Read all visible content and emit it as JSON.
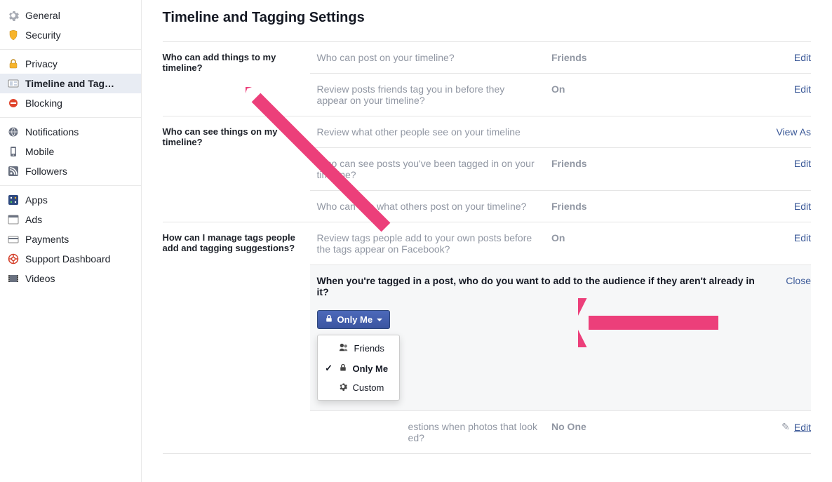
{
  "sidebar": {
    "groups": [
      {
        "items": [
          {
            "label": "General",
            "icon": "gear"
          },
          {
            "label": "Security",
            "icon": "shield"
          }
        ]
      },
      {
        "items": [
          {
            "label": "Privacy",
            "icon": "lock"
          },
          {
            "label": "Timeline and Tag…",
            "icon": "timeline",
            "active": true
          },
          {
            "label": "Blocking",
            "icon": "block"
          }
        ]
      },
      {
        "items": [
          {
            "label": "Notifications",
            "icon": "globe"
          },
          {
            "label": "Mobile",
            "icon": "mobile"
          },
          {
            "label": "Followers",
            "icon": "rss"
          }
        ]
      },
      {
        "items": [
          {
            "label": "Apps",
            "icon": "apps"
          },
          {
            "label": "Ads",
            "icon": "ads"
          },
          {
            "label": "Payments",
            "icon": "payments"
          },
          {
            "label": "Support Dashboard",
            "icon": "support"
          },
          {
            "label": "Videos",
            "icon": "videos"
          }
        ]
      }
    ]
  },
  "page": {
    "title": "Timeline and Tagging Settings"
  },
  "sections": [
    {
      "heading": "Who can add things to my timeline?",
      "rows": [
        {
          "label": "Who can post on your timeline?",
          "value": "Friends",
          "action": "Edit"
        },
        {
          "label": "Review posts friends tag you in before they appear on your timeline?",
          "value": "On",
          "action": "Edit"
        }
      ]
    },
    {
      "heading": "Who can see things on my timeline?",
      "rows": [
        {
          "label": "Review what other people see on your timeline",
          "value": "",
          "action": "View As"
        },
        {
          "label": "Who can see posts you've been tagged in on your timeline?",
          "value": "Friends",
          "action": "Edit"
        },
        {
          "label": "Who can see what others post on your timeline?",
          "value": "Friends",
          "action": "Edit"
        }
      ]
    },
    {
      "heading": "How can I manage tags people add and tagging suggestions?",
      "rows": [
        {
          "label": "Review tags people add to your own posts before the tags appear on Facebook?",
          "value": "On",
          "action": "Edit"
        },
        {
          "expanded": true,
          "question": "When you're tagged in a post, who do you want to add to the audience if they aren't already in it?",
          "button_label": "Only Me",
          "close_label": "Close",
          "dropdown": [
            {
              "label": "Friends",
              "icon": "friends"
            },
            {
              "label": "Only Me",
              "icon": "lock",
              "selected": true
            },
            {
              "label": "Custom",
              "icon": "custom"
            }
          ]
        },
        {
          "label": "Who sees tag suggestions when photos that look like you are uploaded?",
          "label_cut": "estions when photos that look\ned?",
          "value": "No One",
          "action": "Edit",
          "pencil": true
        }
      ]
    }
  ],
  "colors": {
    "link": "#3b5998",
    "muted": "#9197a3",
    "annotation": "#ec3f7a"
  }
}
